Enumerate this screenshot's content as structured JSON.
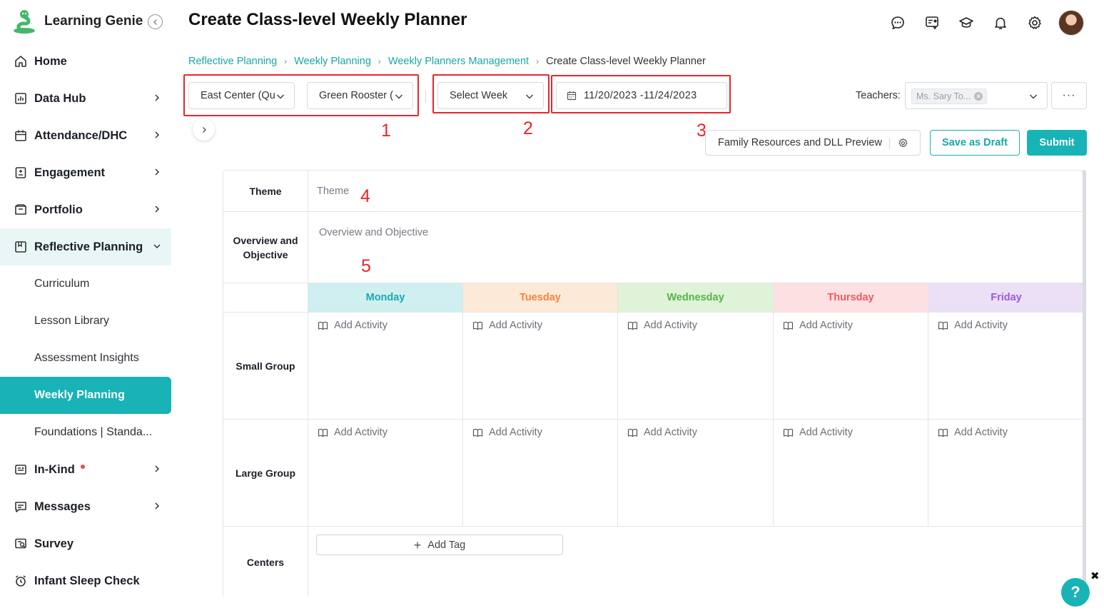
{
  "app": {
    "name": "Learning Genie"
  },
  "sidebar": {
    "items": [
      {
        "label": "Home",
        "icon": "home-icon"
      },
      {
        "label": "Data Hub",
        "icon": "bar-chart-icon"
      },
      {
        "label": "Attendance/DHC",
        "icon": "calendar-icon"
      },
      {
        "label": "Engagement",
        "icon": "engagement-icon"
      },
      {
        "label": "Portfolio",
        "icon": "portfolio-icon"
      },
      {
        "label": "Reflective Planning",
        "icon": "planning-icon"
      },
      {
        "label": "In-Kind",
        "icon": "in-kind-icon"
      },
      {
        "label": "Messages",
        "icon": "message-icon"
      },
      {
        "label": "Survey",
        "icon": "survey-icon"
      },
      {
        "label": "Infant Sleep Check",
        "icon": "alarm-clock-icon"
      }
    ],
    "subitems": [
      {
        "label": "Curriculum"
      },
      {
        "label": "Lesson Library"
      },
      {
        "label": "Assessment Insights"
      },
      {
        "label": "Weekly Planning"
      },
      {
        "label": "Foundations | Standa..."
      }
    ]
  },
  "header": {
    "title": "Create Class-level Weekly Planner",
    "icons": [
      "chat-icon",
      "feedback-icon",
      "graduation-cap-icon",
      "bell-icon",
      "gear-icon"
    ]
  },
  "breadcrumb": {
    "items": [
      "Reflective Planning",
      "Weekly Planning",
      "Weekly Planners Management"
    ],
    "current": "Create Class-level Weekly Planner"
  },
  "filters": {
    "center": "East Center (Qu",
    "group": "Green Rooster (",
    "week": "Select Week",
    "date_range": "11/20/2023 -11/24/2023",
    "teachers_label": "Teachers:",
    "teacher_tag": "Ms. Sary To...",
    "more": "···"
  },
  "annotations": [
    "1",
    "2",
    "3",
    "4",
    "5"
  ],
  "actions": {
    "preview": "Family Resources and DLL Preview",
    "draft": "Save as Draft",
    "submit": "Submit"
  },
  "planner": {
    "theme_label": "Theme",
    "theme_placeholder": "Theme",
    "overview_label_1": "Overview and",
    "overview_label_2": "Objective",
    "overview_placeholder": "Overview and Objective",
    "days": [
      {
        "name": "Monday",
        "bg": "#cfeff1",
        "color": "#1aa9b0"
      },
      {
        "name": "Tuesday",
        "bg": "#fde9d8",
        "color": "#f0873b"
      },
      {
        "name": "Wednesday",
        "bg": "#dff3d8",
        "color": "#56b44a"
      },
      {
        "name": "Thursday",
        "bg": "#fde0e2",
        "color": "#ee5a63"
      },
      {
        "name": "Friday",
        "bg": "#ece0f7",
        "color": "#9b59d6"
      }
    ],
    "small_group_label": "Small Group",
    "large_group_label": "Large Group",
    "centers_label": "Centers",
    "add_activity": "Add Activity",
    "add_tag": "Add Tag"
  },
  "help": {
    "label": "?",
    "close": "✖"
  },
  "colors": {
    "accent": "#17b3b6",
    "annotation": "#e8262c"
  }
}
